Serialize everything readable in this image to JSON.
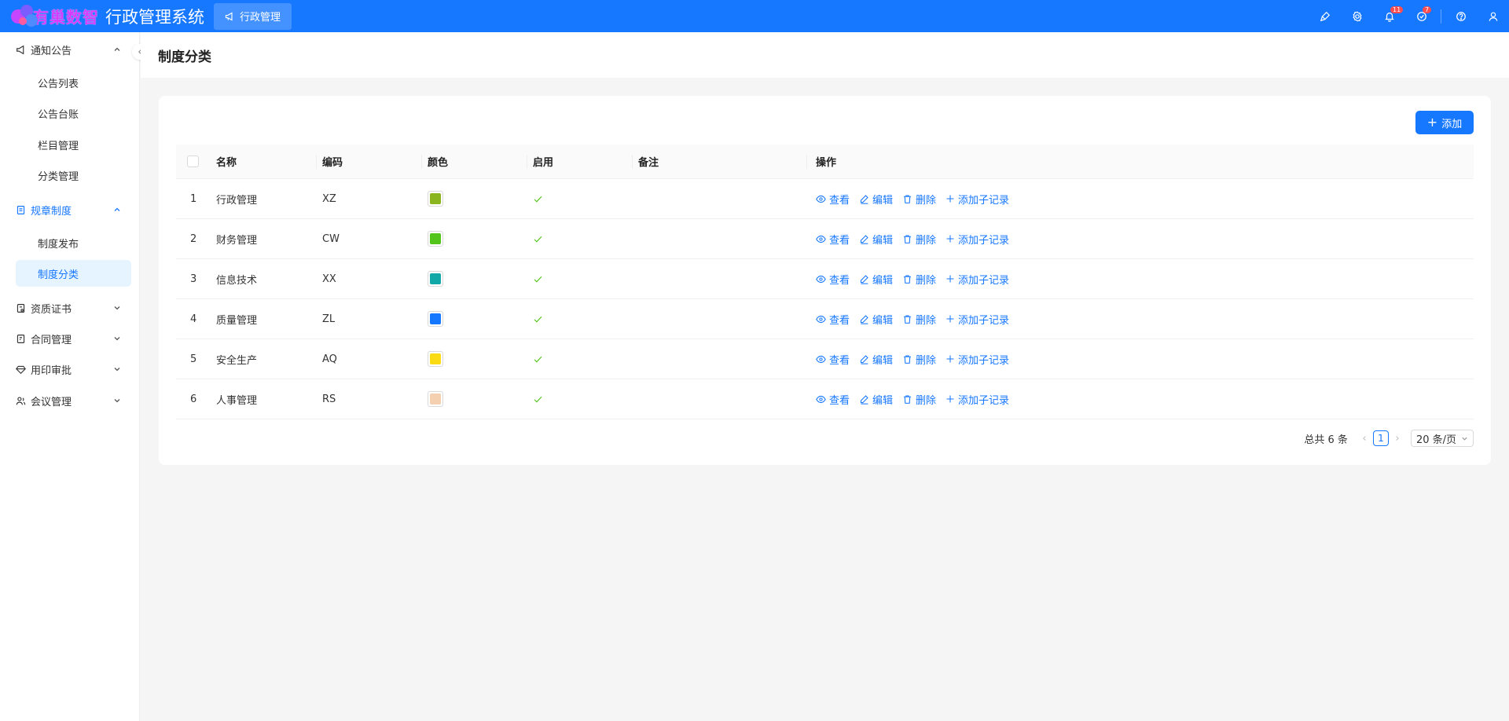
{
  "header": {
    "logo_text": "有巢数智",
    "system_title": "行政管理系统",
    "active_module": "行政管理",
    "notification_badge": "11",
    "task_badge": "7"
  },
  "sidebar": {
    "groups": [
      {
        "label": "通知公告",
        "expanded": true,
        "items": [
          "公告列表",
          "公告台账",
          "栏目管理",
          "分类管理"
        ]
      },
      {
        "label": "规章制度",
        "expanded": true,
        "active": true,
        "items": [
          "制度发布",
          "制度分类"
        ]
      },
      {
        "label": "资质证书",
        "expanded": false
      },
      {
        "label": "合同管理",
        "expanded": false
      },
      {
        "label": "用印审批",
        "expanded": false
      },
      {
        "label": "会议管理",
        "expanded": false
      }
    ],
    "selected_item": "制度分类"
  },
  "page": {
    "title": "制度分类",
    "add_label": "添加"
  },
  "table": {
    "columns": [
      "名称",
      "编码",
      "颜色",
      "启用",
      "备注",
      "操作"
    ],
    "action_labels": {
      "view": "查看",
      "edit": "编辑",
      "delete": "删除",
      "add_child": "添加子记录"
    },
    "rows": [
      {
        "index": "1",
        "name": "行政管理",
        "code": "XZ",
        "color": "#8bb51f",
        "enabled": true,
        "remark": ""
      },
      {
        "index": "2",
        "name": "财务管理",
        "code": "CW",
        "color": "#52c41a",
        "enabled": true,
        "remark": ""
      },
      {
        "index": "3",
        "name": "信息技术",
        "code": "XX",
        "color": "#13a8a8",
        "enabled": true,
        "remark": ""
      },
      {
        "index": "4",
        "name": "质量管理",
        "code": "ZL",
        "color": "#1677ff",
        "enabled": true,
        "remark": ""
      },
      {
        "index": "5",
        "name": "安全生产",
        "code": "AQ",
        "color": "#fadb14",
        "enabled": true,
        "remark": ""
      },
      {
        "index": "6",
        "name": "人事管理",
        "code": "RS",
        "color": "#f5d0b0",
        "enabled": true,
        "remark": ""
      }
    ]
  },
  "pagination": {
    "total_text": "总共 6 条",
    "current_page": "1",
    "page_size": "20 条/页"
  },
  "colors": {
    "primary": "#1677ff",
    "check": "#52c41a"
  }
}
